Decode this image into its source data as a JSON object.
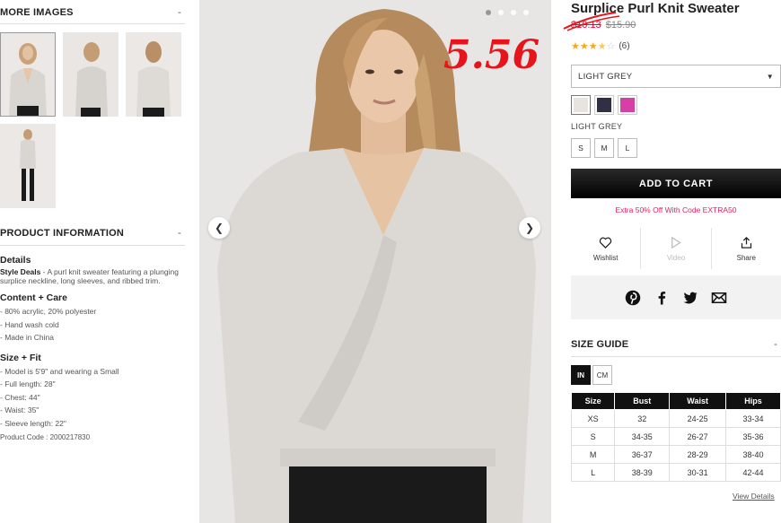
{
  "left": {
    "more_images": {
      "title": "MORE IMAGES",
      "toggle": "-"
    },
    "product_info": {
      "title": "PRODUCT INFORMATION",
      "toggle": "-"
    },
    "details": {
      "heading": "Details",
      "brand": "Style Deals",
      "description": " - A purl knit sweater featuring a plunging surplice neckline, long sleeves, and ribbed trim."
    },
    "content_care": {
      "heading": "Content + Care",
      "items": [
        "- 80% acrylic, 20% polyester",
        "- Hand wash cold",
        "- Made in China"
      ]
    },
    "size_fit": {
      "heading": "Size + Fit",
      "items": [
        "- Model is 5'9\" and wearing a Small",
        "- Full length: 28\"",
        "- Chest: 44\"",
        "- Waist: 35\"",
        "- Sleeve length: 22\""
      ]
    },
    "product_code": "Product Code : 2000217830"
  },
  "main": {
    "overlay_price": "5.56",
    "prev_icon": "chevron-left-icon",
    "next_icon": "chevron-right-icon",
    "dots_active": 1
  },
  "product": {
    "title": "Surplice Purl Knit Sweater",
    "sale_price": "$10.13",
    "original_price": "$15.90",
    "rating": 3.5,
    "review_count": "(6)",
    "selected_color": "LIGHT GREY",
    "swatches": [
      "#e7e4df",
      "#2f3043",
      "#d63fa6"
    ],
    "color_label": "LIGHT GREY",
    "sizes": [
      "S",
      "M",
      "L"
    ],
    "add_to_cart": "ADD TO CART",
    "promo": "Extra 50% Off With Code EXTRA50",
    "actions": {
      "wishlist": "Wishlist",
      "video": "Video",
      "share": "Share"
    }
  },
  "size_guide": {
    "title": "SIZE GUIDE",
    "toggle": "-",
    "units": [
      "IN",
      "CM"
    ],
    "headers": [
      "Size",
      "Bust",
      "Waist",
      "Hips"
    ],
    "rows": [
      [
        "XS",
        "32",
        "24-25",
        "33-34"
      ],
      [
        "S",
        "34-35",
        "26-27",
        "35-36"
      ],
      [
        "M",
        "36-37",
        "28-29",
        "38-40"
      ],
      [
        "L",
        "38-39",
        "30-31",
        "42-44"
      ]
    ],
    "view_details": "View Details"
  }
}
